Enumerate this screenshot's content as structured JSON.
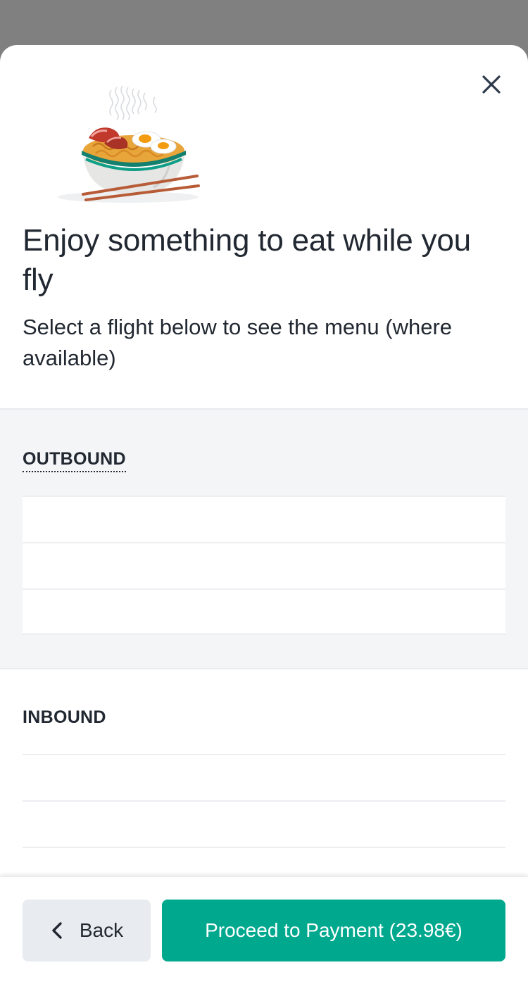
{
  "modal": {
    "title": "Enjoy something to eat while you fly",
    "subtitle": "Select a flight below to see the menu (where available)"
  },
  "icons": {
    "close": "close-icon",
    "illustration": "noodle-bowl-illustration",
    "back": "chevron-left-icon"
  },
  "outbound": {
    "label": "OUTBOUND",
    "rows": [
      "",
      "",
      ""
    ]
  },
  "inbound": {
    "label": "INBOUND",
    "rows": [
      "",
      "",
      ""
    ]
  },
  "footer": {
    "back_label": "Back",
    "proceed_label": "Proceed to Payment (23.98€)"
  },
  "colors": {
    "accent": "#00a88e",
    "text": "#222831",
    "section_bg": "#f4f5f7",
    "back_button_bg": "#e8ebef"
  }
}
